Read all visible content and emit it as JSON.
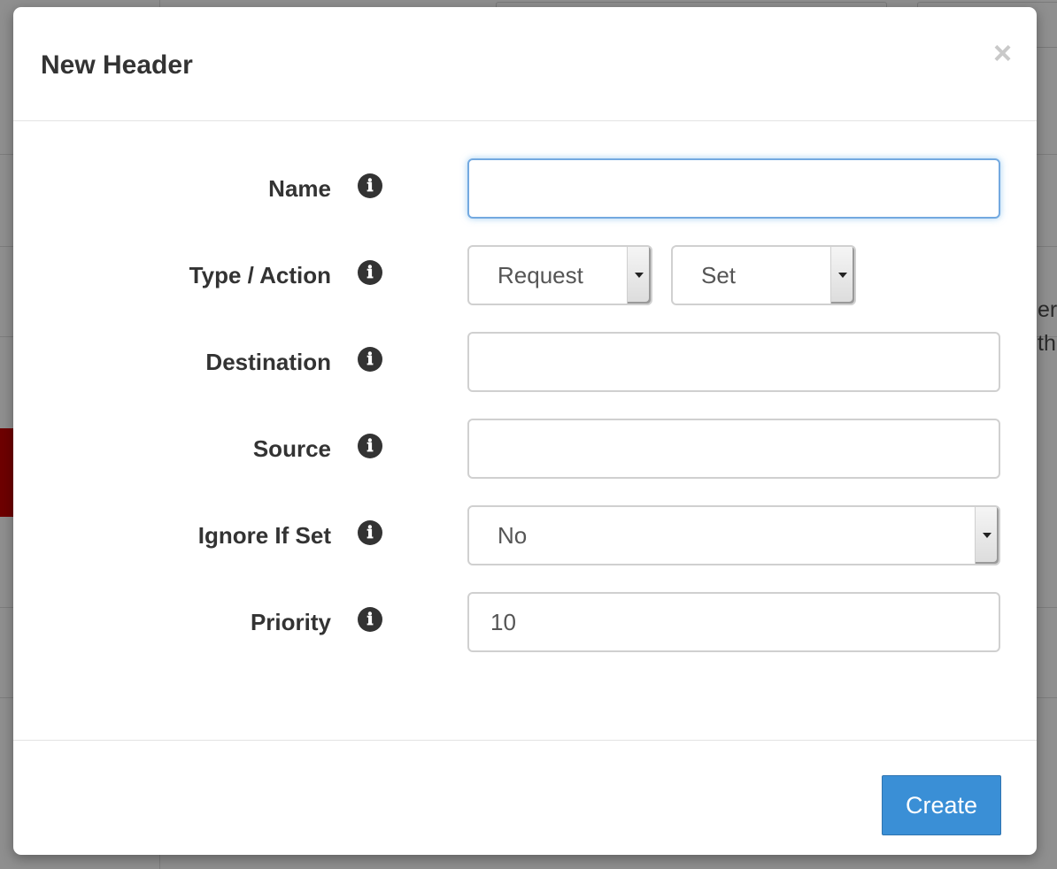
{
  "background": {
    "peek_lines": [
      "er",
      "th"
    ]
  },
  "modal": {
    "title": "New Header",
    "close_label": "×",
    "create_label": "Create"
  },
  "form": {
    "name": {
      "label": "Name",
      "value": "",
      "info_icon": "ℹ"
    },
    "type_action": {
      "label": "Type / Action",
      "type_value": "Request",
      "action_value": "Set",
      "info_icon": "ℹ"
    },
    "destination": {
      "label": "Destination",
      "value": "",
      "info_icon": "ℹ"
    },
    "source": {
      "label": "Source",
      "value": "",
      "info_icon": "ℹ"
    },
    "ignore_if_set": {
      "label": "Ignore If Set",
      "value": "No",
      "info_icon": "ℹ"
    },
    "priority": {
      "label": "Priority",
      "value": "10",
      "info_icon": "ℹ"
    }
  },
  "colors": {
    "primary_button": "#3a8fd6",
    "focus_border": "#73a9e0",
    "overlay": "#8f8f8f"
  }
}
